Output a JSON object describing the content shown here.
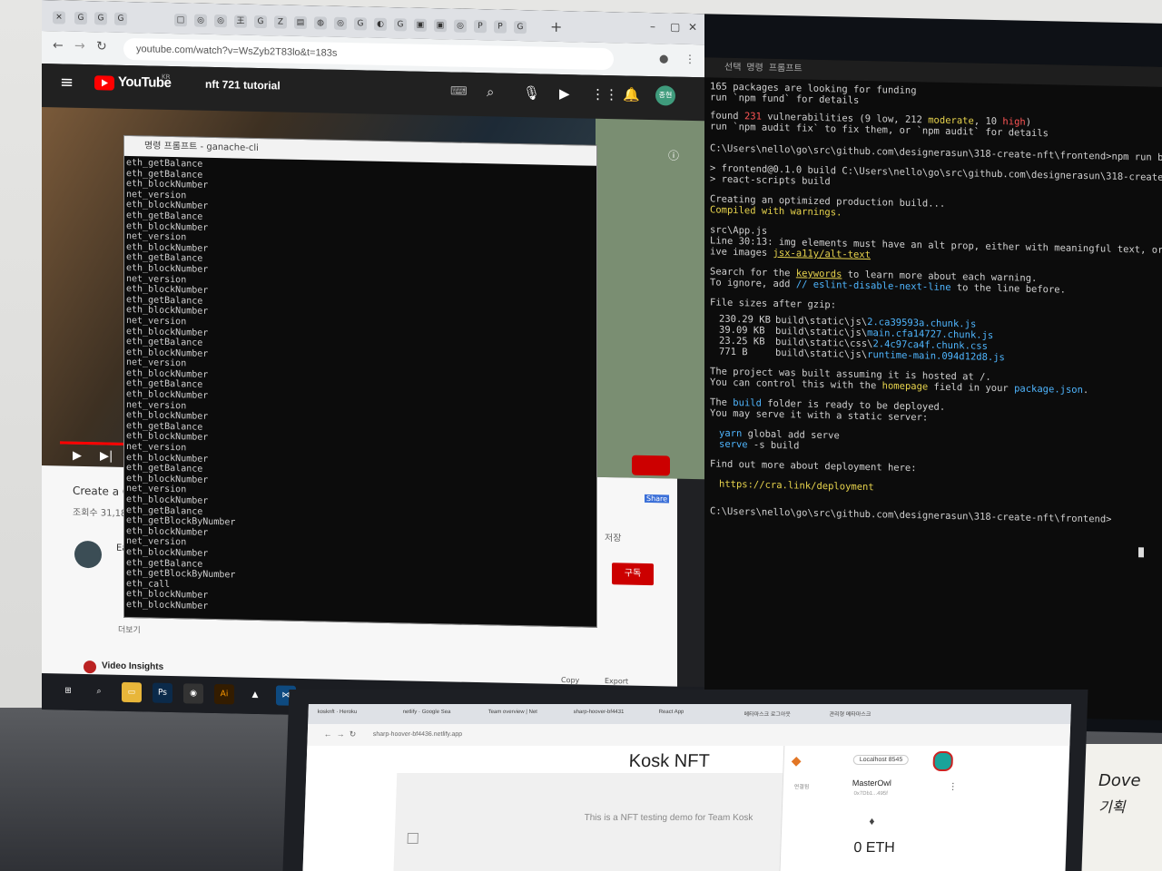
{
  "browser": {
    "url": "youtube.com/watch?v=WsZyb2T83lo&t=183s",
    "search_query": "nft 721 tutorial",
    "yt_logo": "YouTube",
    "yt_region": "KR",
    "avatar": "종현",
    "video_title_partial": "Create a C",
    "views_partial": "조회수 31,18",
    "channel_partial": "Ea",
    "more": "더보기",
    "save": "저장",
    "subscribe": "구독",
    "video_insights": "Video Insights",
    "copy": "Copy",
    "export": "Export",
    "share": "Share"
  },
  "cmd_left": {
    "title": "명령 프롬프트 - ganache-cli",
    "lines": [
      "eth_getBalance",
      "eth_getBalance",
      "eth_blockNumber",
      "net_version",
      "eth_blockNumber",
      "eth_getBalance",
      "eth_blockNumber",
      "net_version",
      "eth_blockNumber",
      "eth_getBalance",
      "eth_blockNumber",
      "net_version",
      "eth_blockNumber",
      "eth_getBalance",
      "eth_blockNumber",
      "net_version",
      "eth_blockNumber",
      "eth_getBalance",
      "eth_blockNumber",
      "net_version",
      "eth_blockNumber",
      "eth_getBalance",
      "eth_blockNumber",
      "net_version",
      "eth_blockNumber",
      "eth_getBalance",
      "eth_blockNumber",
      "net_version",
      "eth_blockNumber",
      "eth_getBalance",
      "eth_blockNumber",
      "net_version",
      "eth_blockNumber",
      "eth_getBalance",
      "eth_getBlockByNumber",
      "eth_blockNumber",
      "net_version",
      "eth_blockNumber",
      "eth_getBalance",
      "eth_getBlockByNumber",
      "eth_call",
      "eth_blockNumber",
      "eth_blockNumber"
    ]
  },
  "cmd_right": {
    "title": "선택 명령 프롬프트",
    "l1": "165 packages are looking for funding",
    "l2": "  run `npm fund` for details",
    "l3a": "found ",
    "l3b": "231",
    "l3c": " vulnerabilities (9 low, 212 ",
    "l3d": "moderate",
    "l3e": ", 10 ",
    "l3f": "high",
    "l3g": ")",
    "l4": "  run `npm audit fix` to fix them, or `npm audit` for details",
    "l5": "C:\\Users\\nello\\go\\src\\github.com\\designerasun\\318-create-nft\\frontend>npm run build",
    "l6": "> frontend@0.1.0 build C:\\Users\\nello\\go\\src\\github.com\\designerasun\\318-create-nft\\fr",
    "l7": "> react-scripts build",
    "l8": "Creating an optimized production build...",
    "l9": "Compiled with warnings.",
    "l10": "src\\App.js",
    "l11": "  Line 30:13:  img elements must have an alt prop, either with meaningful text, or an e",
    "l12a": "ive images  ",
    "l12b": "jsx-a11y/alt-text",
    "l13a": "Search for the ",
    "l13b": "keywords",
    "l13c": " to learn more about each warning.",
    "l14a": "To ignore, add ",
    "l14b": "// eslint-disable-next-line",
    "l14c": " to the line before.",
    "l15": "File sizes after gzip:",
    "files": [
      {
        "size": "230.29 KB",
        "dir": "build\\static\\js\\",
        "name": "2.ca39593a.chunk.js"
      },
      {
        "size": "39.09 KB",
        "dir": "build\\static\\js\\",
        "name": "main.cfa14727.chunk.js"
      },
      {
        "size": "23.25 KB",
        "dir": "build\\static\\css\\",
        "name": "2.4c97ca4f.chunk.css"
      },
      {
        "size": "771 B",
        "dir": "build\\static\\js\\",
        "name": "runtime-main.094d12d8.js"
      }
    ],
    "l16": "The project was built assuming it is hosted at /.",
    "l17a": "You can control this with the ",
    "l17b": "homepage",
    "l17c": " field in your ",
    "l17d": "package.json",
    "l17e": ".",
    "l18a": "The ",
    "l18b": "build",
    "l18c": " folder is ready to be deployed.",
    "l19": "You may serve it with a static server:",
    "l20a": "yarn",
    "l20b": " global add serve",
    "l21a": "serve",
    "l21b": " -s build",
    "l22": "Find out more about deployment here:",
    "l23": "https://cra.link/deployment",
    "l24": "C:\\Users\\nello\\go\\src\\github.com\\designerasun\\318-create-nft\\frontend>"
  },
  "laptop": {
    "tabs": [
      "kosknft · Heroku",
      "netlify · Google Sea",
      "Team overview | Net",
      "sharp-hoover-bf4431",
      "React App",
      "메타마스크 로그아웃",
      "관리형 메타마스크"
    ],
    "url": "sharp-hoover-bf4436.netlify.app",
    "site_title": "Kosk NFT",
    "tagline": "This is a NFT testing demo for Team Kosk",
    "network": "Localhost 8545",
    "account": "MasterOwl",
    "address": "0x7Db1...495f",
    "status": "연결됨",
    "balance": "0 ETH"
  },
  "note": {
    "l1": "Dove",
    "l2": "기획"
  }
}
